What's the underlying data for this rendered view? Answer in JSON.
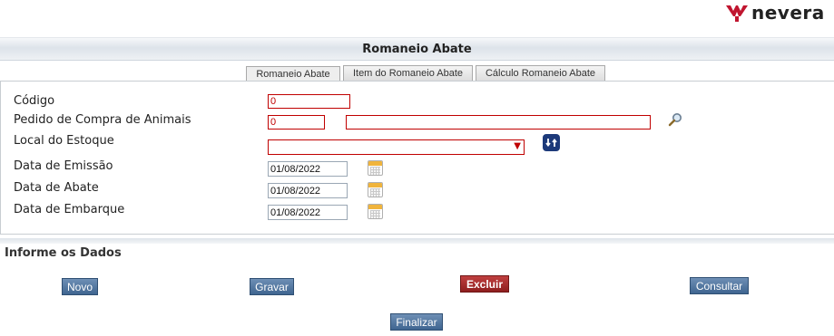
{
  "brand": {
    "name": "nevera",
    "logo_color": "#c0152f"
  },
  "header": {
    "title": "Romaneio Abate"
  },
  "tabs": [
    {
      "label": "Romaneio Abate",
      "active": true
    },
    {
      "label": "Item do Romaneio Abate",
      "active": false
    },
    {
      "label": "Cálculo Romaneio Abate",
      "active": false
    }
  ],
  "form": {
    "codigo": {
      "label": "Código",
      "value": "0"
    },
    "pedido": {
      "label": "Pedido de Compra de Animais",
      "value": "0",
      "description": ""
    },
    "local": {
      "label": "Local do Estoque",
      "selected": ""
    },
    "data_emissao": {
      "label": "Data de Emissão",
      "value": "01/08/2022"
    },
    "data_abate": {
      "label": "Data de Abate",
      "value": "01/08/2022"
    },
    "data_embarque": {
      "label": "Data de Embarque",
      "value": "01/08/2022"
    }
  },
  "section": {
    "title": "Informe os Dados"
  },
  "buttons": {
    "novo": "Novo",
    "gravar": "Gravar",
    "excluir": "Excluir",
    "consultar": "Consultar",
    "finalizar": "Finalizar"
  },
  "icons": {
    "search": "search-icon",
    "refresh": "refresh-icon",
    "calendar": "calendar-icon"
  },
  "colors": {
    "required_border": "#c00000",
    "button_blue": "#3f6590",
    "button_red": "#8e1e1e"
  }
}
